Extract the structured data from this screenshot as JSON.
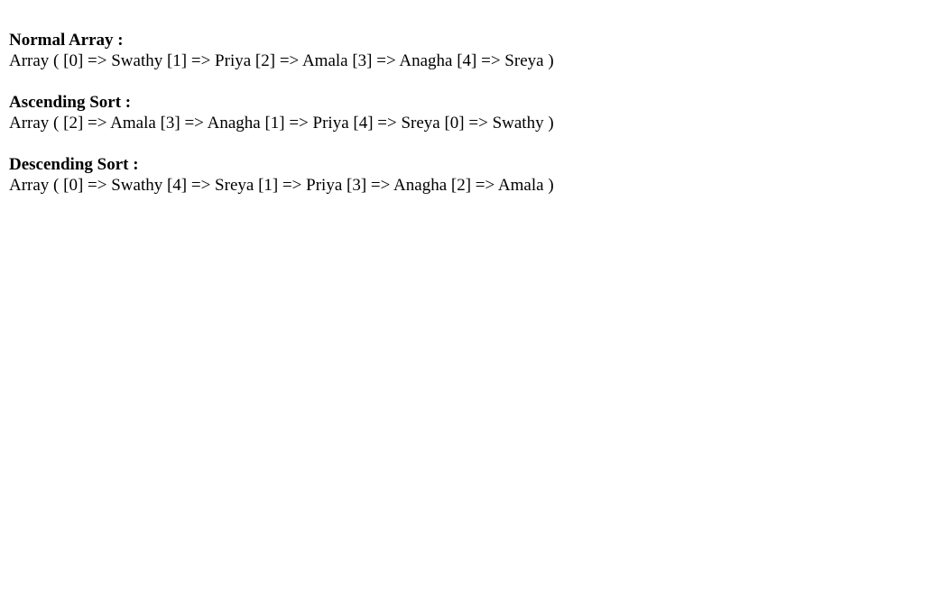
{
  "sections": [
    {
      "heading": "Normal Array :",
      "output": "Array ( [0] => Swathy [1] => Priya [2] => Amala [3] => Anagha [4] => Sreya )"
    },
    {
      "heading": "Ascending Sort :",
      "output": "Array ( [2] => Amala [3] => Anagha [1] => Priya [4] => Sreya [0] => Swathy )"
    },
    {
      "heading": "Descending Sort :",
      "output": "Array ( [0] => Swathy [4] => Sreya [1] => Priya [3] => Anagha [2] => Amala )"
    }
  ]
}
